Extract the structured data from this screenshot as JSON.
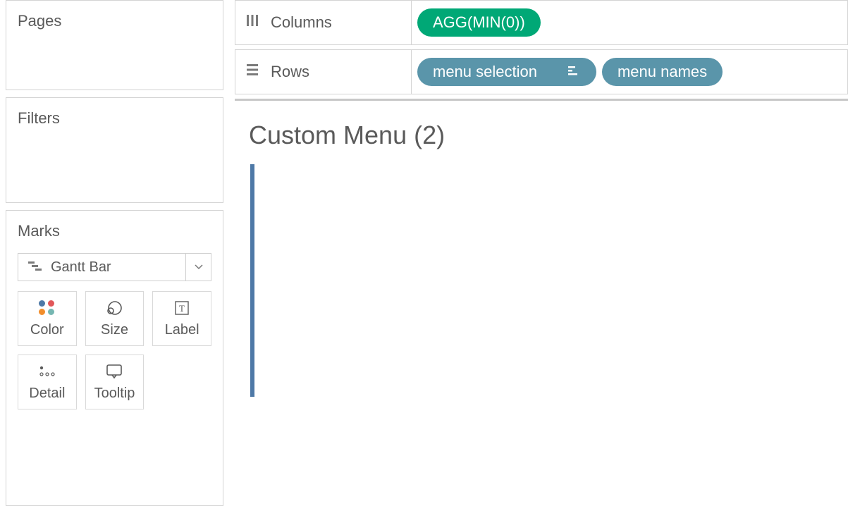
{
  "sidebar": {
    "pages": {
      "title": "Pages"
    },
    "filters": {
      "title": "Filters"
    },
    "marks": {
      "title": "Marks",
      "mark_type": "Gantt Bar",
      "buttons": {
        "color": "Color",
        "size": "Size",
        "label": "Label",
        "detail": "Detail",
        "tooltip": "Tooltip"
      }
    }
  },
  "shelves": {
    "columns": {
      "label": "Columns",
      "pills": [
        {
          "text": "AGG(MIN(0))",
          "color": "green"
        }
      ]
    },
    "rows": {
      "label": "Rows",
      "pills": [
        {
          "text": "menu selection",
          "color": "blue",
          "has_sort_icon": true
        },
        {
          "text": "menu names",
          "color": "blue"
        }
      ]
    }
  },
  "canvas": {
    "title": "Custom Menu (2)"
  }
}
